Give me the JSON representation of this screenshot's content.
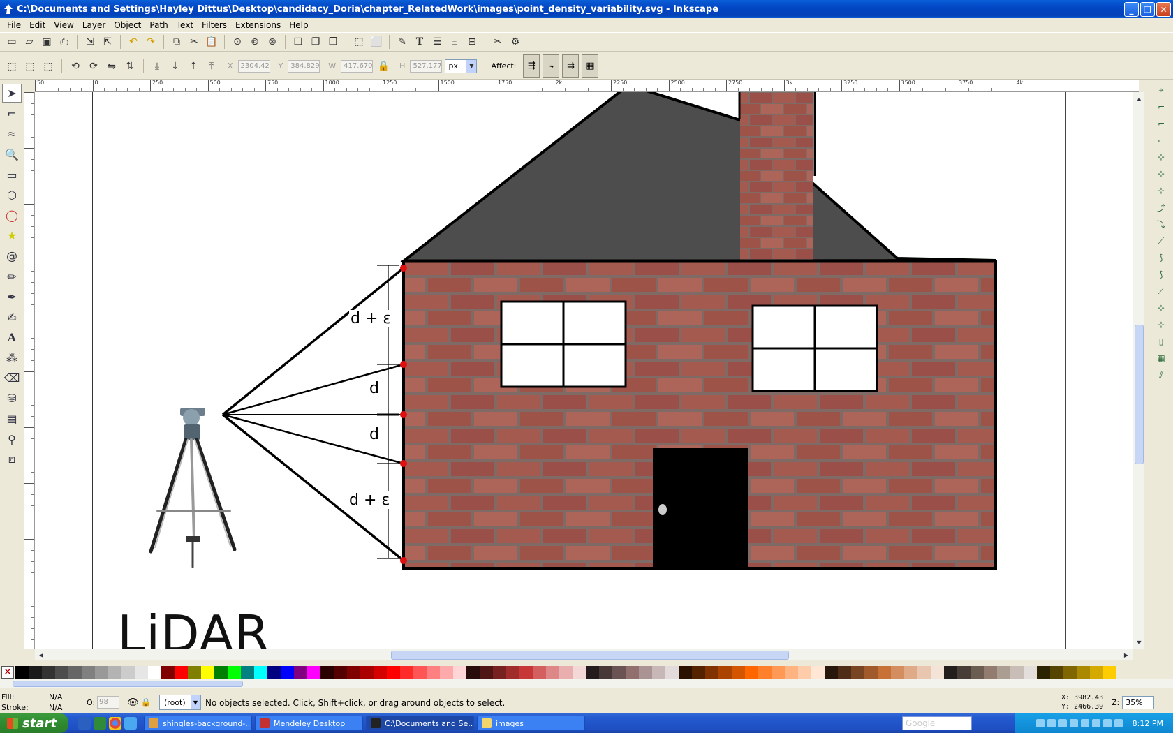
{
  "window": {
    "title": "C:\\Documents and Settings\\Hayley Dittus\\Desktop\\candidacy_Doria\\chapter_RelatedWork\\images\\point_density_variability.svg - Inkscape"
  },
  "menu": [
    "File",
    "Edit",
    "View",
    "Layer",
    "Object",
    "Path",
    "Text",
    "Filters",
    "Extensions",
    "Help"
  ],
  "toolbar": {
    "x_label": "X",
    "x_value": "2304.42",
    "y_label": "Y",
    "y_value": "384.829",
    "w_label": "W",
    "w_value": "417.670",
    "h_label": "H",
    "h_value": "527.177",
    "unit": "px",
    "affect_label": "Affect:"
  },
  "ruler": {
    "labels": [
      "50",
      "0",
      "250",
      "500",
      "750",
      "1000",
      "1250",
      "1500",
      "1750",
      "2k",
      "2250",
      "2500",
      "2750",
      "3k",
      "3250",
      "3500",
      "3750",
      "4k"
    ]
  },
  "drawing": {
    "label_top": "d + ε",
    "label_mid_upper": "d",
    "label_mid_lower": "d",
    "label_bottom": "d + ε",
    "lidar_text": "LiDAR"
  },
  "status": {
    "fill_label": "Fill:",
    "fill_value": "N/A",
    "stroke_label": "Stroke:",
    "stroke_value": "N/A",
    "opacity_label": "O:",
    "opacity_value": "98",
    "layer": "(root)",
    "message": "No objects selected. Click, Shift+click, or drag around objects to select.",
    "x_coord": "X: 3982.43",
    "y_coord": "Y: 2466.39",
    "zoom_label": "Z:",
    "zoom_value": "35%"
  },
  "taskbar": {
    "start": "start",
    "tasks": [
      "shingles-background-...",
      "Mendeley Desktop",
      "C:\\Documents and Se...",
      "images"
    ],
    "search_placeholder": "Google",
    "clock": "8:12 PM"
  },
  "colors": {
    "brick": "#a55a4f",
    "mortar": "#7f6a66",
    "roof": "#4d4d4d",
    "red_point": "#e01010",
    "title_bar": "#0347c4",
    "taskbar": "#245ad0"
  },
  "palette": [
    "#000000",
    "#1a1a1a",
    "#333333",
    "#4d4d4d",
    "#666666",
    "#808080",
    "#999999",
    "#b3b3b3",
    "#cccccc",
    "#e6e6e6",
    "#ffffff",
    "#800000",
    "#ff0000",
    "#808000",
    "#ffff00",
    "#008000",
    "#00ff00",
    "#008080",
    "#00ffff",
    "#000080",
    "#0000ff",
    "#800080",
    "#ff00ff",
    "#2b0000",
    "#550000",
    "#800000",
    "#aa0000",
    "#d40000",
    "#ff0000",
    "#ff2a2a",
    "#ff5555",
    "#ff8080",
    "#ffaaaa",
    "#ffd5d5",
    "#280b0b",
    "#501616",
    "#782121",
    "#a02c2c",
    "#c83737",
    "#d35f5f",
    "#de8787",
    "#e9afaf",
    "#f4d7d7",
    "#241c1c",
    "#483737",
    "#6c5353",
    "#916f6f",
    "#ac9393",
    "#c8b7b7",
    "#e3dbdb",
    "#2b1100",
    "#552200",
    "#803300",
    "#aa4400",
    "#d45500",
    "#ff6600",
    "#ff7f2a",
    "#ff9955",
    "#ffb380",
    "#ffccaa",
    "#ffe6d5",
    "#28170b",
    "#502d16",
    "#784421",
    "#a05a2c",
    "#c87137",
    "#d38d5f",
    "#deaa87",
    "#e9c6af",
    "#f4e3d7",
    "#241f1c",
    "#483e37",
    "#6c5d53",
    "#917c6f",
    "#ac9d93",
    "#c8beb7",
    "#e3dedb",
    "#2b2200",
    "#554400",
    "#806600",
    "#aa8800",
    "#d4aa00",
    "#ffcc00"
  ]
}
